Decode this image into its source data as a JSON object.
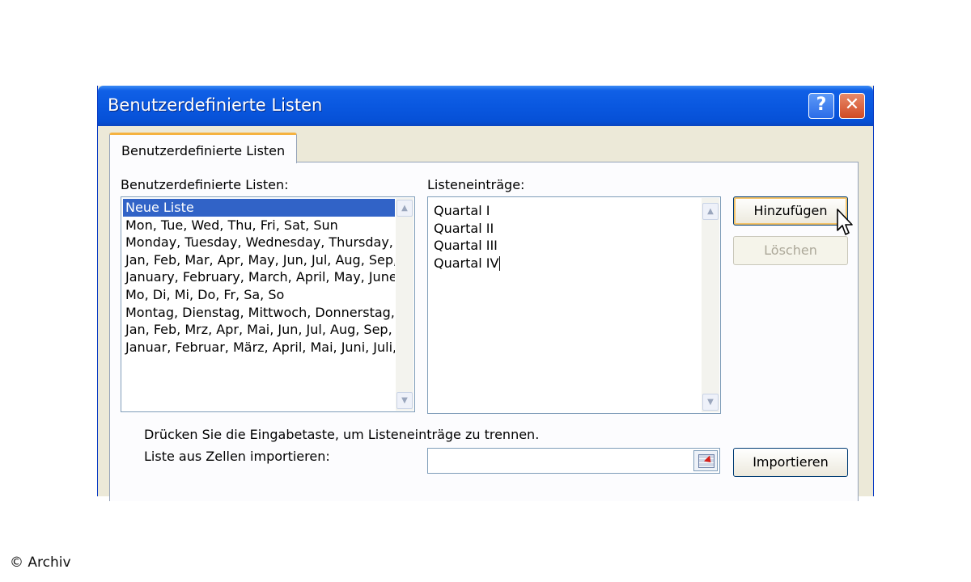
{
  "window": {
    "title": "Benutzerdefinierte Listen",
    "help_glyph": "?",
    "close_glyph": "✕"
  },
  "tab": {
    "label": "Benutzerdefinierte Listen"
  },
  "lists": {
    "label": "Benutzerdefinierte Listen:",
    "items": [
      "Neue Liste",
      "Mon, Tue, Wed, Thu, Fri, Sat, Sun",
      "Monday, Tuesday, Wednesday, Thursday, Friday, Saturday, Sunday",
      "Jan, Feb, Mar, Apr, May, Jun, Jul, Aug, Sep, Oct, Nov, Dec",
      "January, February, March, April, May, June, July, August, September, October, November, December",
      "Mo, Di, Mi, Do, Fr, Sa, So",
      "Montag, Dienstag, Mittwoch, Donnerstag, Freitag, Samstag, Sonntag",
      "Jan, Feb, Mrz, Apr, Mai, Jun, Jul, Aug, Sep, Okt, Nov, Dez",
      "Januar, Februar, März, April, Mai, Juni, Juli, August, September, Oktober, November, Dezember"
    ],
    "selected": "Neue Liste"
  },
  "entries": {
    "label": "Listeneinträge:",
    "items": [
      "Quartal I",
      "Quartal II",
      "Quartal III",
      "Quartal IV"
    ]
  },
  "buttons": {
    "add": "Hinzufügen",
    "delete": "Löschen",
    "import": "Importieren"
  },
  "hint": "Drücken Sie die Eingabetaste, um Listeneinträge zu trennen.",
  "import_label": "Liste aus Zellen importieren:",
  "import_value": "",
  "credit": "© Archiv",
  "colors": {
    "title_bar": "#0a58e0",
    "selection": "#3163c7",
    "dialog_bg": "#ece9d8"
  },
  "icons": {
    "scroll_up": "▲",
    "scroll_down": "▼"
  }
}
